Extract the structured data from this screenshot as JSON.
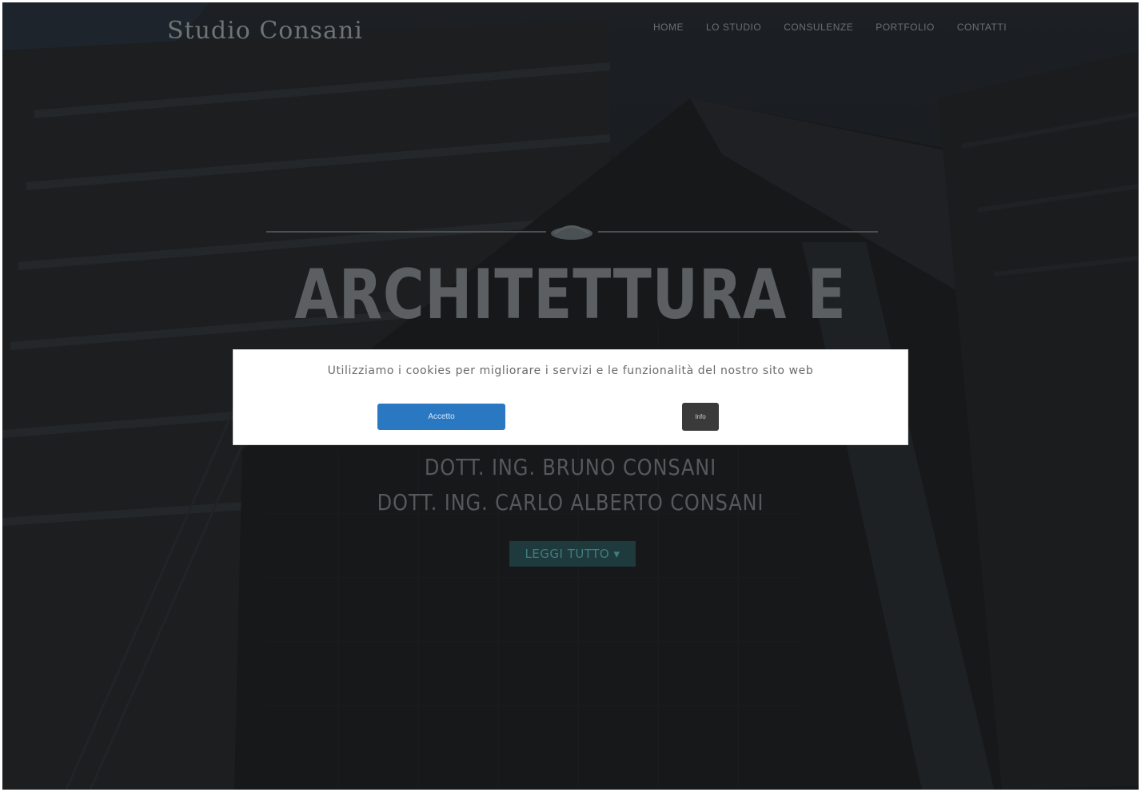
{
  "header": {
    "brand": "Studio Consani",
    "nav": [
      "home",
      "lo studio",
      "consulenze",
      "portfolio",
      "contatti"
    ]
  },
  "hero": {
    "title": "ARCHITETTURA E",
    "names": [
      "DOTT. ING. BRUNO CONSANI",
      "DOTT. ING. CARLO ALBERTO CONSANI"
    ],
    "read_more": "LEGGI TUTTO ▾"
  },
  "cookie_banner": {
    "message": "Utilizziamo i cookies per migliorare i servizi e le funzionalità del nostro sito web",
    "accept_label": "Accetto",
    "info_label": "Info"
  },
  "colors": {
    "accept_button": "#2a78c2",
    "info_button": "#3a3a3a",
    "read_more_bg": "#1f3a3d"
  }
}
